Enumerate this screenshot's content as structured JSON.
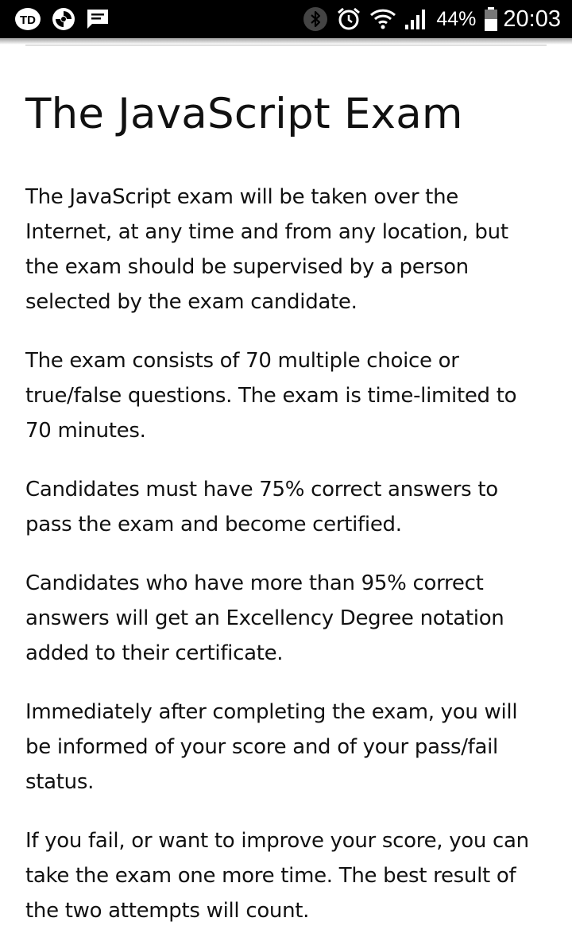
{
  "status_bar": {
    "battery_percent": "44%",
    "time": "20:03",
    "icons": [
      "td-app-icon",
      "swirl-app-icon",
      "message-icon",
      "bluetooth-icon",
      "alarm-icon",
      "wifi-icon",
      "signal-icon",
      "battery-icon"
    ]
  },
  "page": {
    "title": "The JavaScript Exam",
    "paragraphs": [
      "The JavaScript exam will be taken over the Internet, at any time and from any location, but the exam should be supervised by a person selected by the exam candidate.",
      "The exam consists of 70 multiple choice or true/false questions. The exam is time-limited to 70 minutes.",
      "Candidates must have 75% correct answers to pass the exam and become certified.",
      "Candidates who have more than 95% correct answers will get an Excellency Degree notation added to their certificate.",
      "Immediately after completing the exam, you will be informed of your score and of your pass/fail status.",
      "If you fail, or want to improve your score, you can take the exam one more time. The best result of the two attempts will count."
    ]
  }
}
